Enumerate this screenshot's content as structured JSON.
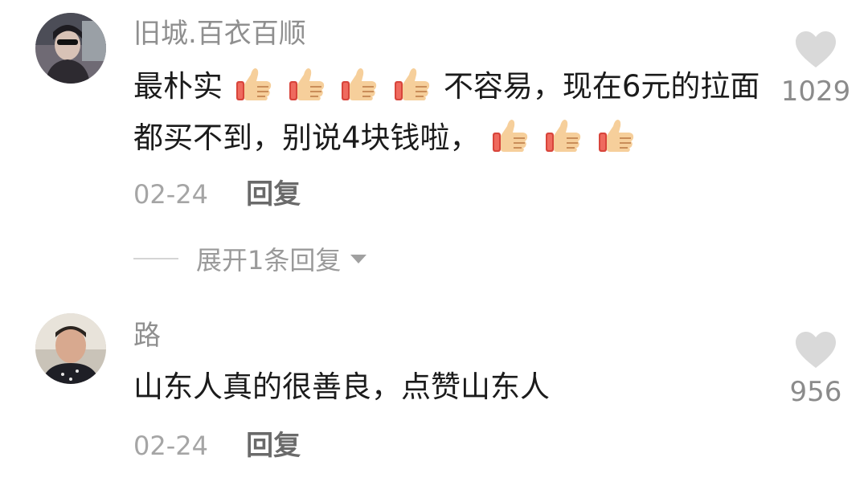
{
  "comments": [
    {
      "username": "旧城.百衣百顺",
      "content_segments": [
        {
          "text": "最朴实"
        },
        {
          "icon": "thumbs-up-emoji"
        },
        {
          "icon": "thumbs-up-emoji"
        },
        {
          "icon": "thumbs-up-emoji"
        },
        {
          "icon": "thumbs-up-emoji"
        },
        {
          "text": "不容易，现在6元的拉面都买不到，别说4块钱啦，"
        },
        {
          "icon": "thumbs-up-emoji"
        },
        {
          "icon": "thumbs-up-emoji"
        },
        {
          "icon": "thumbs-up-emoji"
        }
      ],
      "date": "02-24",
      "reply_label": "回复",
      "like_count": "1029",
      "expand_replies_label": "展开1条回复"
    },
    {
      "username": "路",
      "content_segments": [
        {
          "text": "山东人真的很善良，点赞山东人"
        }
      ],
      "date": "02-24",
      "reply_label": "回复",
      "like_count": "956"
    }
  ],
  "colors": {
    "username": "#8f8f8f",
    "content": "#1b1b1b",
    "date": "#a5a5a5",
    "reply": "#6a6a6a",
    "like_heart": "#d9d9d9",
    "like_count": "#8b8b8b"
  }
}
